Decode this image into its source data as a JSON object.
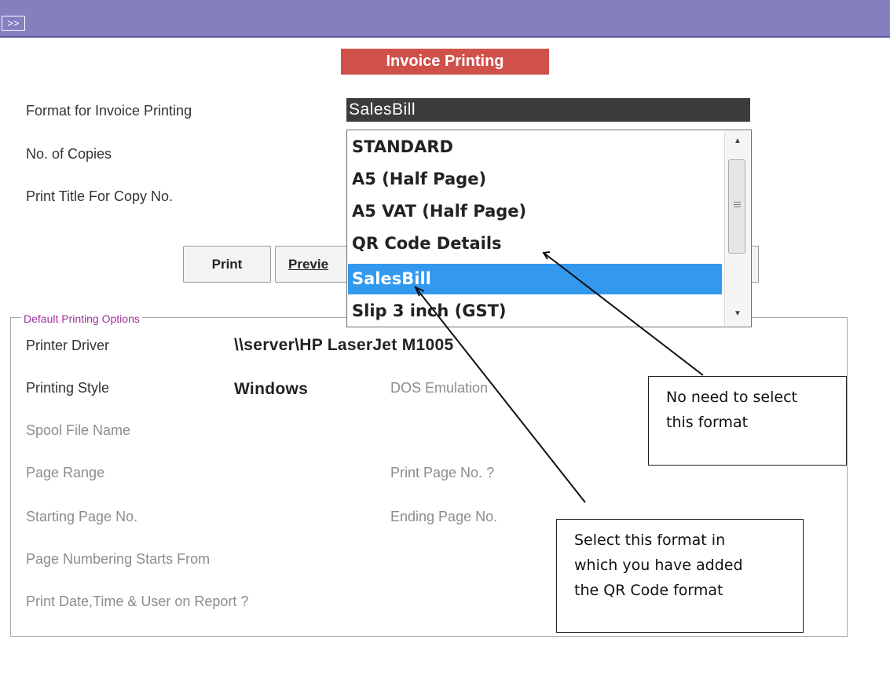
{
  "titlebar": {
    "expand_label": ">>"
  },
  "page_title": "Invoice Printing",
  "fields": {
    "format_label": "Format for Invoice Printing",
    "format_value": "SalesBill",
    "copies_label": "No. of Copies",
    "print_title_label": "Print Title For Copy No."
  },
  "buttons": {
    "print": "Print",
    "preview": "Previe"
  },
  "dropdown": {
    "options": [
      "STANDARD",
      "A5 (Half Page)",
      "A5 VAT (Half Page)",
      "QR Code Details",
      "SalesBill",
      "Slip 3 inch (GST)"
    ],
    "selected": "SalesBill",
    "scroll_up_glyph": "▲",
    "scroll_down_glyph": "▼"
  },
  "group": {
    "legend": "Default Printing Options",
    "printer_driver_label": "Printer Driver",
    "printer_driver_value": "\\\\server\\HP LaserJet M1005",
    "printing_style_label": "Printing Style",
    "printing_style_value": "Windows",
    "dos_emulation_label": "DOS Emulation",
    "spool_label": "Spool File Name",
    "page_range_label": "Page Range",
    "print_page_no_label": "Print Page No. ?",
    "starting_page_label": "Starting Page No.",
    "ending_page_label": "Ending Page No.",
    "numbering_label": "Page Numbering Starts From",
    "print_datetime_label": "Print Date,Time & User on Report ?"
  },
  "callouts": {
    "no_need": [
      "No need to select",
      "this format"
    ],
    "select_this": [
      "Select this format in",
      "which you have added",
      "the QR Code format"
    ]
  },
  "colors": {
    "titlebar": "#8480c0",
    "page_title_bg": "#d0504a",
    "selection": "#3399ee",
    "format_field_bg": "#3c3c3c"
  }
}
